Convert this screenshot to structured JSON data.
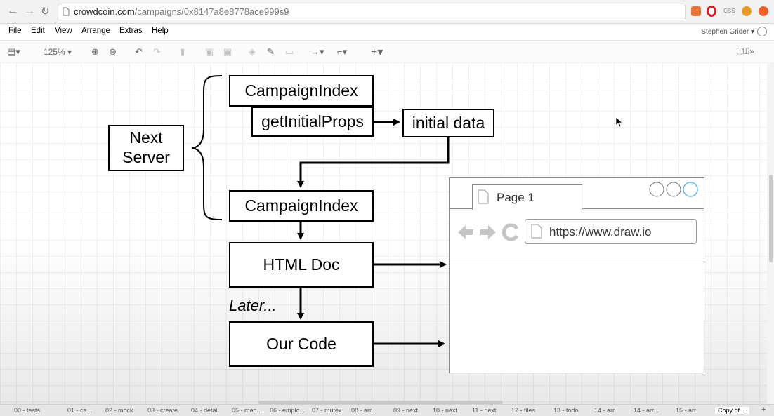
{
  "browser": {
    "url_host": "crowdcoin.com",
    "url_path": "/campaigns/0x8147a8e8778ace999s9",
    "extensions": [
      "bookmark-icon",
      "opera-icon",
      "css-icon",
      "fox-icon",
      "brave-icon"
    ]
  },
  "menu": [
    "File",
    "Edit",
    "View",
    "Arrange",
    "Extras",
    "Help"
  ],
  "user": "Stephen Grider ▾",
  "toolbar": {
    "zoom": "125% ▾"
  },
  "diagram": {
    "next_server": "Next Server",
    "campaign_index_top": "CampaignIndex",
    "get_initial_props": "getInitialProps",
    "initial_data": "initial data",
    "campaign_index_bottom": "CampaignIndex",
    "html_doc": "HTML Doc",
    "later": "Later...",
    "our_code": "Our Code"
  },
  "mockup": {
    "tab_title": "Page 1",
    "url": "https://www.draw.io"
  },
  "page_tabs": [
    "00 - tests",
    "01 - ca...",
    "02 - mock",
    "03 - create",
    "04 - detail",
    "05 - man...",
    "06 - emplo...",
    "07 - mutex",
    "08 - arr...",
    "09 - next",
    "10 - next",
    "11 - next",
    "12 - files",
    "13 - todo",
    "14 - arr",
    "14 - arr...",
    "15 - arr",
    "Copy of ..."
  ],
  "colors": {
    "accent": "#e8753a",
    "mock_circle_active": "#6ab7e0"
  }
}
